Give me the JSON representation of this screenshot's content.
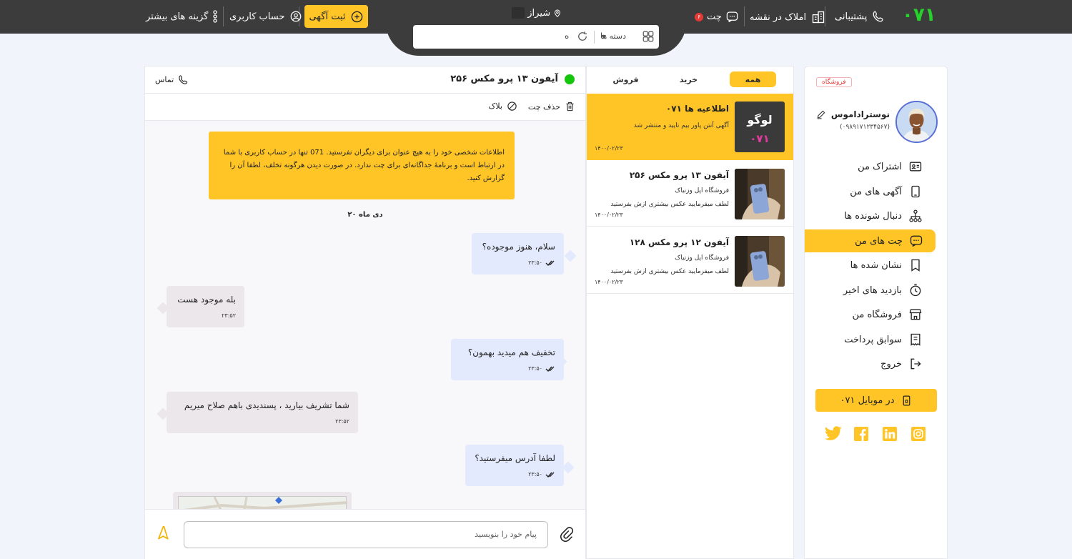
{
  "header": {
    "logo": "۰۷۱",
    "support_label": "پشتیبانی",
    "map_label": "املاک در نقشه",
    "chat_label": "چت",
    "chat_badge": "۶",
    "city": "شیراز",
    "post_ad_label": "ثبت آگهی",
    "account_label": "حساب کاربری",
    "more_label": "گزینه های بیشتر",
    "search": {
      "categories_label": "دسته ها",
      "value": "ه"
    }
  },
  "sidebar": {
    "store_badge": "فروشگاه",
    "user_name": "نوستراداموس",
    "user_phone": "(۰۹۸۹۱۷۱۲۳۴۵۶۷)",
    "items": [
      {
        "label": "اشتراک من",
        "icon": "id-card-icon"
      },
      {
        "label": "آگهی های من",
        "icon": "mobile-icon"
      },
      {
        "label": "دنبال شونده ها",
        "icon": "hierarchy-icon"
      },
      {
        "label": "چت های من",
        "icon": "chat-icon"
      },
      {
        "label": "نشان شده ها",
        "icon": "bookmark-icon"
      },
      {
        "label": "بازدید های اخیر",
        "icon": "timer-icon"
      },
      {
        "label": "فروشگاه من",
        "icon": "store-icon"
      },
      {
        "label": "سوابق پرداخت",
        "icon": "receipt-icon"
      },
      {
        "label": "خروج",
        "icon": "logout-icon"
      }
    ],
    "mobile_app_label": "۰۷۱ در موبایل",
    "socials": [
      "twitter-icon",
      "facebook-icon",
      "linkedin-icon",
      "instagram-icon"
    ]
  },
  "chat_list": {
    "tabs": [
      "همه",
      "خرید",
      "فروش"
    ],
    "active_tab": "همه",
    "items": [
      {
        "title": "اطلاعیه ها ۰۷۱",
        "subtitle": "آگهی آنتن پاور بیم تایید و منتشر شد",
        "date": "۱۴۰۰/۰۲/۲۳",
        "thumb_text": "لوگو",
        "thumb_sub": "۰۷۱"
      },
      {
        "title": "آیفون ۱۳ پرو مکس ۲۵۶",
        "shop": "فروشگاه اپل وزنیاک",
        "subtitle": "لطف میفرمایید عکس بیشتری ازش بفرستید",
        "date": "۱۴۰۰/۰۲/۲۳"
      },
      {
        "title": "آیفون ۱۲ پرو مکس ۱۲۸",
        "shop": "فروشگاه اپل وزنیاک",
        "subtitle": "لطف میفرمایید عکس بیشتری ازش بفرستید",
        "date": "۱۴۰۰/۰۲/۲۳"
      }
    ]
  },
  "chat_window": {
    "title": "آیفون ۱۳ پرو مکس ۲۵۶",
    "call_label": "تماس",
    "delete_label": "حذف چت",
    "block_label": "بلاک",
    "notice": "اطلاعات شخصی خود را به هیچ عنوان برای دیگران نفرستید. 071 تنها در حساب کاربری با شما در ارتباط است و برنامهٔ جداگانه‌ای برای چت ندارد. در صورت دیدن هرگونه تخلف، لطفا آن را گزارش کنید.",
    "date_divider": "۲۰ دی ماه",
    "messages": [
      {
        "text": "سلام، هنوز موجوده؟",
        "time": "۲۳:۵۰",
        "dir": "out"
      },
      {
        "text": "بله موجود هست",
        "time": "۲۳:۵۲",
        "dir": "in"
      },
      {
        "text": "تخفیف هم میدید بهمون؟",
        "time": "۲۳:۵۰",
        "dir": "out"
      },
      {
        "text": "شما تشریف بیارید ، پسندیدی باهم صلاح میریم",
        "time": "۲۳:۵۲",
        "dir": "in"
      },
      {
        "text": "لطفا آدرس میفرستید؟",
        "time": "۲۳:۵۰",
        "dir": "out"
      }
    ],
    "input_placeholder": "پیام خود را بنویسید"
  },
  "colors": {
    "accent": "#ffc527",
    "topbar": "#3c3c3c",
    "logo_green": "#27d12b",
    "online": "#16c60c",
    "badge_red": "#e53935"
  }
}
